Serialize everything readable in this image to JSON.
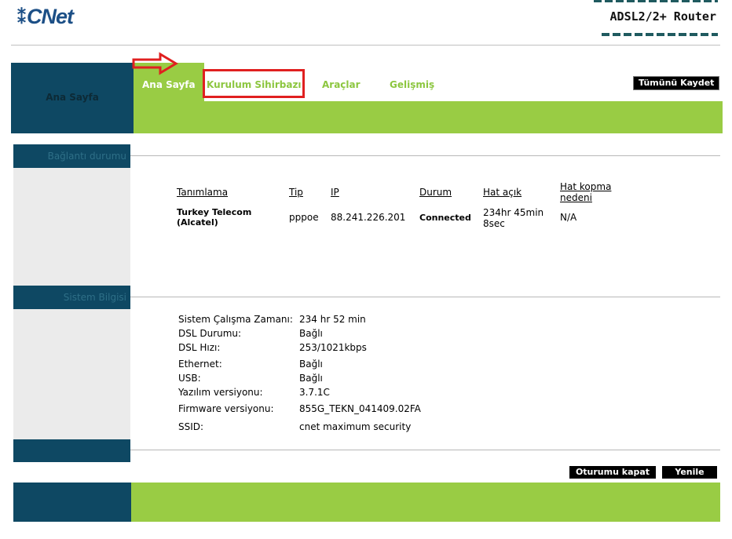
{
  "header": {
    "logo_text": "CNet",
    "logo_mark": "⁑",
    "router_title": "ADSL2/2+ Router"
  },
  "nav": {
    "left_label": "Ana Sayfa",
    "tabs": [
      {
        "label": "Ana Sayfa",
        "active": true
      },
      {
        "label": "Kurulum Sihirbazı",
        "active": false
      },
      {
        "label": "Araçlar",
        "active": false
      },
      {
        "label": "Gelişmiş",
        "active": false
      }
    ],
    "save_all": "Tümünü Kaydet"
  },
  "connection": {
    "section_label": "Bağlantı durumu",
    "headers": [
      "Tanımlama",
      "Tip",
      "IP",
      "Durum",
      "Hat açık",
      "Hat kopma nedeni"
    ],
    "row": {
      "name": "Turkey Telecom (Alcatel)",
      "type": "pppoe",
      "ip": "88.241.226.201",
      "status": "Connected",
      "uptime": "234hr 45min 8sec",
      "reason": "N/A"
    }
  },
  "system": {
    "section_label": "Sistem Bilgisi",
    "rows": [
      {
        "label": "Sistem Çalışma Zamanı:",
        "value": "234 hr 52 min"
      },
      {
        "label": "DSL Durumu:",
        "value": "Bağlı"
      },
      {
        "label": "DSL Hızı:",
        "value": "253/1021kbps"
      },
      {
        "label": "Ethernet:",
        "value": "Bağlı"
      },
      {
        "label": "USB:",
        "value": "Bağlı"
      },
      {
        "label": "Yazılım versiyonu:",
        "value": "3.7.1C"
      },
      {
        "label": "Firmware versiyonu:",
        "value": "855G_TEKN_041409.02FA"
      },
      {
        "label": "SSID:",
        "value": "cnet maximum security"
      }
    ]
  },
  "actions": {
    "logout": "Oturumu kapat",
    "refresh": "Yenile"
  },
  "colors": {
    "green": "#99cc44",
    "dark_blue": "#0e4863",
    "highlight_red": "#e02020"
  }
}
